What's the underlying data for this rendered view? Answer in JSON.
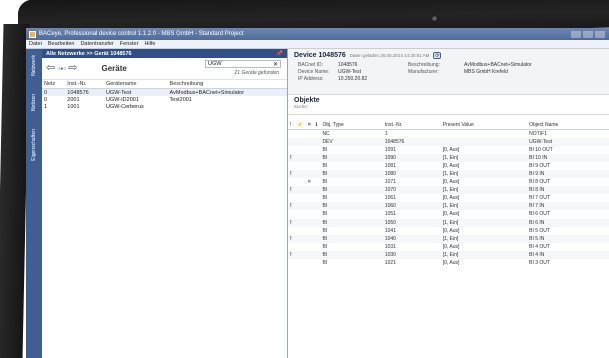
{
  "window": {
    "title": "BACeye, Professional device control 1.1.2.0 - MBS GmbH - Standard Project"
  },
  "menu": [
    "Datei",
    "Bearbeiten",
    "Datentransfer",
    "Fenster",
    "Hilfe"
  ],
  "side_tabs": [
    "Netzwerk",
    "Notizen",
    "Eigenschaften"
  ],
  "left_panel": {
    "header": "Alle Netzwerke >> Gerät 1048576",
    "title": "Geräte",
    "search_value": "UGW",
    "found_text": "21 Geräte gefunden",
    "columns": [
      "Netz",
      "Inst.-Nr.",
      "Gerätename",
      "Beschreibung"
    ],
    "rows": [
      {
        "netz": "0",
        "inst": "1048576",
        "name": "UGW-Test",
        "desc": "AvModbus+BACnet+Simulator"
      },
      {
        "netz": "0",
        "inst": "2001",
        "name": "UGW-ID2001",
        "desc": "Test2001"
      },
      {
        "netz": "1",
        "inst": "1001",
        "name": "UGW-Cerberus",
        "desc": ""
      }
    ]
  },
  "device": {
    "title": "Device 1048576",
    "subtitle": "Daten geladen 26.05.2014 14:30:01 AM",
    "labels": {
      "bacnet_id": "BACnet ID:",
      "device_name": "Device Name:",
      "ip_address": "IP Address:",
      "description": "Beschreibung:",
      "manufacturer": "Manufacturer:"
    },
    "bacnet_id": "1048576",
    "device_name": "UGW-Test",
    "ip_address": "10.250.20.82",
    "description": "AvModbus+BACnet+Simulator",
    "manufacturer": "MBS GmbH Krefeld"
  },
  "objects": {
    "title": "Objekte",
    "search_label": "Suche:",
    "header_icons": {
      "alarm": "!",
      "ack": "⚡",
      "x": "✕",
      "info": "ℹ"
    },
    "columns": [
      "Obj. Type",
      "Inst.-Nr.",
      "Present Value",
      "Object Name"
    ],
    "rows": [
      {
        "alarm": "",
        "x": "",
        "type": "NC",
        "inst": "1",
        "value": "",
        "name": "NOTIF1"
      },
      {
        "alarm": "",
        "x": "",
        "type": "DEV",
        "inst": "1048576",
        "value": "",
        "name": "UGW-Test"
      },
      {
        "alarm": "",
        "x": "",
        "type": "BI",
        "inst": "1091",
        "value": "[0, Aus]",
        "name": "BI 10 OUT"
      },
      {
        "alarm": "!",
        "x": "",
        "type": "BI",
        "inst": "1090",
        "value": "[1, Ein]",
        "name": "BI 10 IN"
      },
      {
        "alarm": "",
        "x": "",
        "type": "BI",
        "inst": "1081",
        "value": "[0, Aus]",
        "name": "BI 9 OUT"
      },
      {
        "alarm": "!",
        "x": "",
        "type": "BI",
        "inst": "1080",
        "value": "[1, Ein]",
        "name": "BI 9 IN"
      },
      {
        "alarm": "",
        "x": "✕",
        "type": "BI",
        "inst": "1071",
        "value": "[0, Aus]",
        "name": "BI 8 OUT"
      },
      {
        "alarm": "!",
        "x": "",
        "type": "BI",
        "inst": "1070",
        "value": "[1, Ein]",
        "name": "BI 8 IN"
      },
      {
        "alarm": "",
        "x": "",
        "type": "BI",
        "inst": "1061",
        "value": "[0, Aus]",
        "name": "BI 7 OUT"
      },
      {
        "alarm": "!",
        "x": "",
        "type": "BI",
        "inst": "1060",
        "value": "[1, Ein]",
        "name": "BI 7 IN"
      },
      {
        "alarm": "",
        "x": "",
        "type": "BI",
        "inst": "1051",
        "value": "[0, Aus]",
        "name": "BI 6 OUT"
      },
      {
        "alarm": "!",
        "x": "",
        "type": "BI",
        "inst": "1050",
        "value": "[1, Ein]",
        "name": "BI 6 IN"
      },
      {
        "alarm": "",
        "x": "",
        "type": "BI",
        "inst": "1041",
        "value": "[0, Aus]",
        "name": "BI 5 OUT"
      },
      {
        "alarm": "!",
        "x": "",
        "type": "BI",
        "inst": "1040",
        "value": "[1, Ein]",
        "name": "BI 5 IN"
      },
      {
        "alarm": "",
        "x": "",
        "type": "BI",
        "inst": "1031",
        "value": "[0, Aus]",
        "name": "BI 4 OUT"
      },
      {
        "alarm": "!",
        "x": "",
        "type": "BI",
        "inst": "1030",
        "value": "[1, Ein]",
        "name": "BI 4 IN"
      },
      {
        "alarm": "",
        "x": "",
        "type": "BI",
        "inst": "1021",
        "value": "[0, Aus]",
        "name": "BI 3 OUT"
      }
    ]
  }
}
